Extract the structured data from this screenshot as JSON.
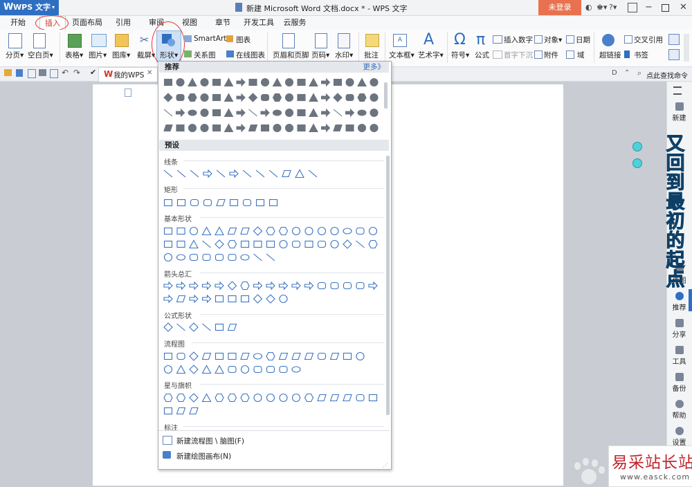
{
  "window": {
    "app_button": "WPS 文字",
    "title": "新建 Microsoft Word 文档.docx * - WPS 文字",
    "login_button": "未登录",
    "help_button": "?"
  },
  "menu": {
    "tabs": [
      "开始",
      "插入",
      "页面布局",
      "引用",
      "审阅",
      "视图",
      "章节",
      "开发工具",
      "云服务"
    ],
    "active": "插入"
  },
  "ribbon": {
    "page_break": "分页",
    "blank_page": "空白页",
    "table": "表格",
    "picture": "图片",
    "gallery": "图库",
    "screenshot": "截屏",
    "shapes": "形状",
    "smartart": "SmartArt",
    "chart": "图表",
    "relation_chart": "关系图",
    "online_chart": "在线图表",
    "header_footer": "页眉和页脚",
    "page_number": "页码",
    "watermark": "水印",
    "comment": "批注",
    "textbox": "文本框",
    "wordart": "艺术字",
    "symbol": "符号",
    "formula": "公式",
    "insert_number": "插入数字",
    "object": "对象",
    "date": "日期",
    "dropcap": "首字下沉",
    "attachment": "附件",
    "field": "域",
    "hyperlink": "超链接",
    "crossref": "交叉引用",
    "bookmark": "书签"
  },
  "quick_bar": {
    "doc_tab": "我的WPS",
    "search_label": "点此查找命令"
  },
  "shapes_panel": {
    "recommend_header": "推荐",
    "more_link": "更多》",
    "preset_header": "预设",
    "sections": [
      "线条",
      "矩形",
      "基本形状",
      "箭头总汇",
      "公式形状",
      "流程图",
      "星与旗帜",
      "标注"
    ],
    "footer": [
      "新建流程图 \\ 脑图(F)",
      "新建绘图画布(N)"
    ]
  },
  "right_panel": {
    "items": [
      "新建",
      "传图",
      "推荐",
      "分享",
      "工具",
      "备份",
      "帮助",
      "设置"
    ]
  },
  "overlay": {
    "big_text": "又回到最初的起点",
    "watermark_text": "易采站长站",
    "watermark_url": "www.easck.com"
  },
  "colors": {
    "accent": "#2f6fc2",
    "login": "#e8724f",
    "annotation": "#e8382f",
    "shape_stroke": "#3a73c4",
    "big_text": "#2480b8"
  }
}
